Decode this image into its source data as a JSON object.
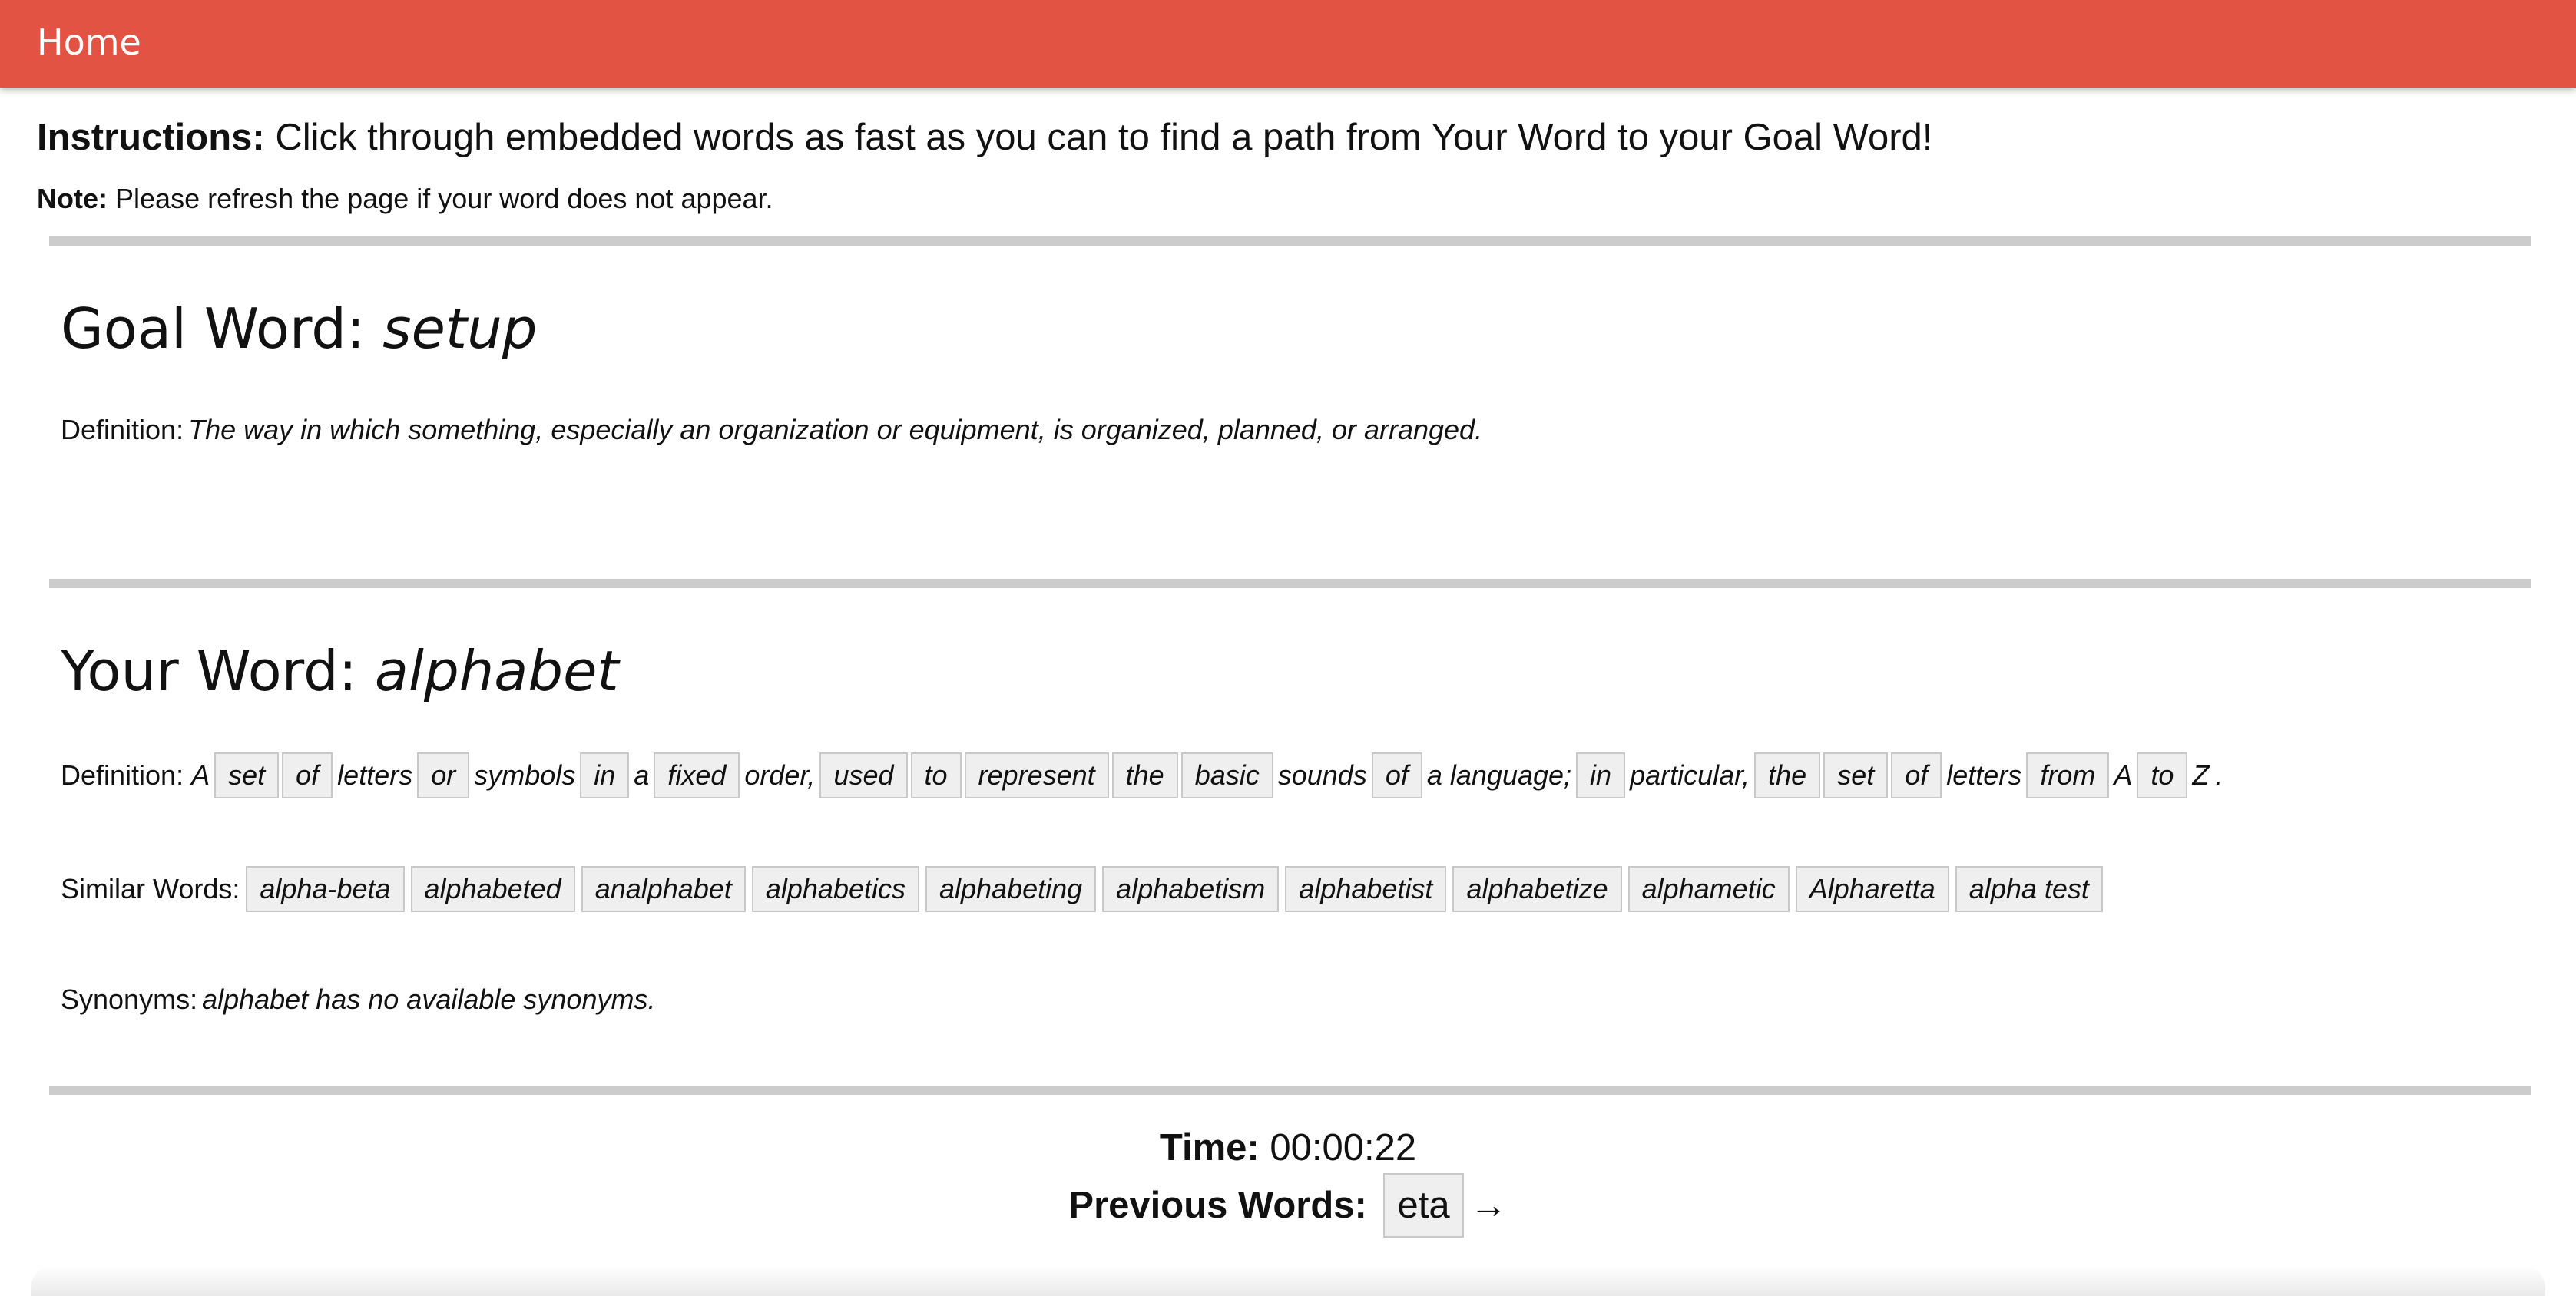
{
  "nav": {
    "home_label": "Home"
  },
  "instructions": {
    "label": "Instructions:",
    "text": "Click through embedded words as fast as you can to find a path from Your Word to your Goal Word!"
  },
  "note": {
    "label": "Note:",
    "text": "Please refresh the page if your word does not appear."
  },
  "goal": {
    "heading": "Goal Word:",
    "word": "setup",
    "definition_label": "Definition:",
    "definition": "The way in which something, especially an organization or equipment, is organized, planned, or arranged."
  },
  "your_word": {
    "heading": "Your Word:",
    "word": "alphabet",
    "definition_label": "Definition:",
    "definition_tokens": [
      {
        "text": "A",
        "link": false
      },
      {
        "text": "set",
        "link": true
      },
      {
        "text": "of",
        "link": true
      },
      {
        "text": "letters",
        "link": false
      },
      {
        "text": "or",
        "link": true
      },
      {
        "text": "symbols",
        "link": false
      },
      {
        "text": "in",
        "link": true
      },
      {
        "text": "a",
        "link": false
      },
      {
        "text": "fixed",
        "link": true
      },
      {
        "text": "order,",
        "link": false
      },
      {
        "text": "used",
        "link": true
      },
      {
        "text": "to",
        "link": true
      },
      {
        "text": "represent",
        "link": true
      },
      {
        "text": "the",
        "link": true
      },
      {
        "text": "basic",
        "link": true
      },
      {
        "text": "sounds",
        "link": false
      },
      {
        "text": "of",
        "link": true
      },
      {
        "text": "a language;",
        "link": false
      },
      {
        "text": "in",
        "link": true
      },
      {
        "text": "particular,",
        "link": false
      },
      {
        "text": "the",
        "link": true
      },
      {
        "text": "set",
        "link": true
      },
      {
        "text": "of",
        "link": true
      },
      {
        "text": "letters",
        "link": false
      },
      {
        "text": "from",
        "link": true
      },
      {
        "text": "A",
        "link": false
      },
      {
        "text": "to",
        "link": true
      },
      {
        "text": "Z",
        "link": false
      },
      {
        "text": ".",
        "link": false
      }
    ],
    "similar_label": "Similar Words:",
    "similar_words": [
      "alpha-beta",
      "alphabeted",
      "analphabet",
      "alphabetics",
      "alphabeting",
      "alphabetism",
      "alphabetist",
      "alphabetize",
      "alphametic",
      "Alpharetta",
      "alpha test"
    ],
    "synonyms_label": "Synonyms:",
    "synonyms_text": "alphabet has no available synonyms."
  },
  "footer": {
    "time_label": "Time:",
    "time_value": "00:00:22",
    "previous_label": "Previous Words:",
    "previous_words": [
      "eta"
    ],
    "arrow": "→"
  },
  "colors": {
    "navbar": "#e25343",
    "rule": "#cccccc",
    "chip_bg": "#efefef",
    "chip_border": "#c8c8c8"
  }
}
